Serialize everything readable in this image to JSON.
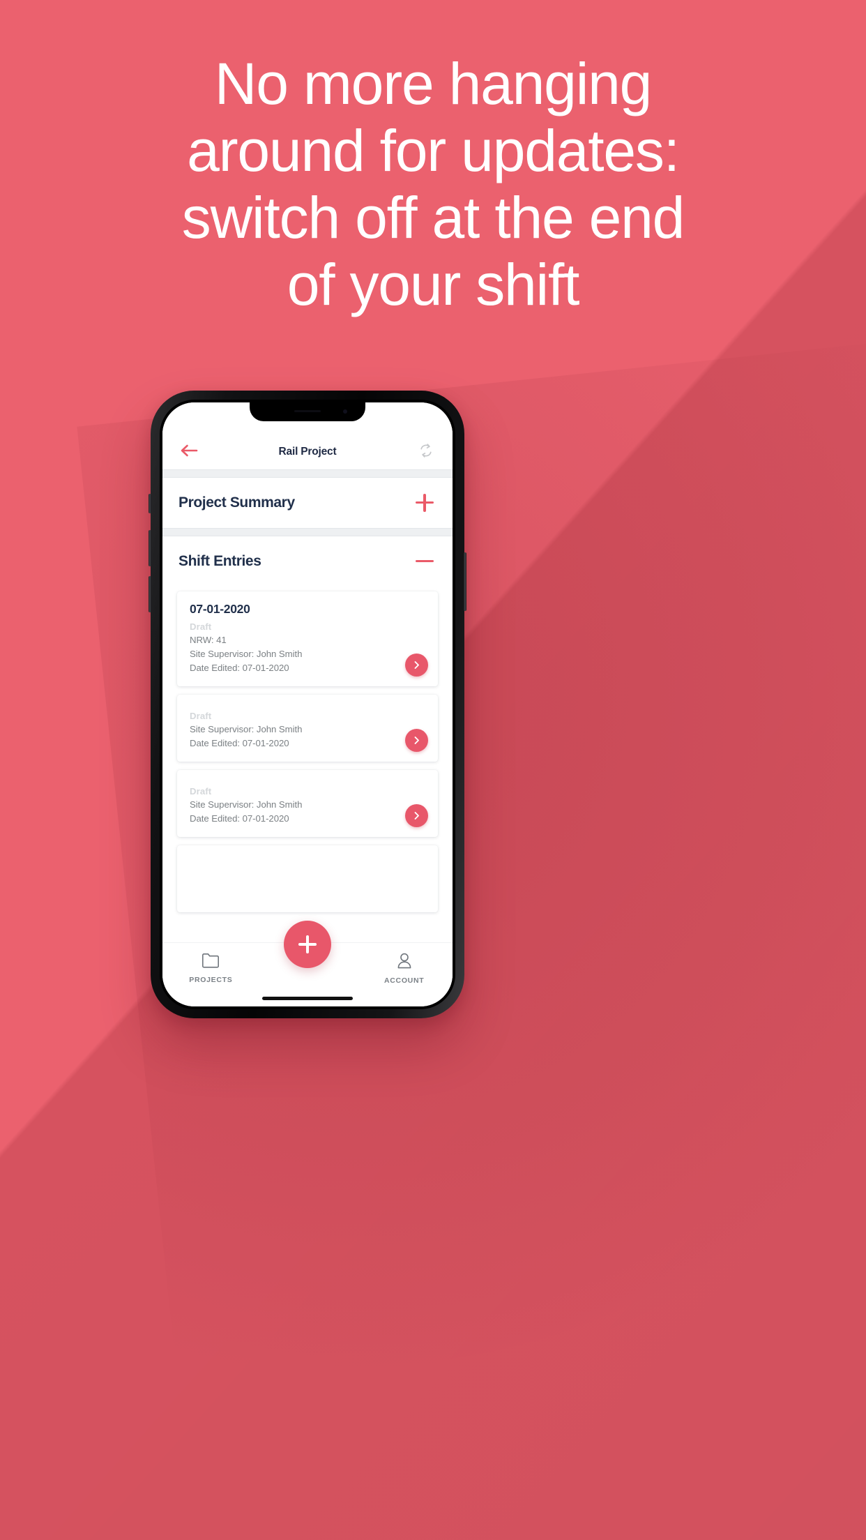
{
  "promo": {
    "background_color": "#ea5a68",
    "headline_color": "#ffffff",
    "headline_lines": [
      "No more hanging",
      "around for updates:",
      "switch off at the end",
      "of your shift"
    ]
  },
  "theme": {
    "accent": "#ea5a68",
    "accent_dark": "#e8576a",
    "title_text": "#21304b",
    "body_text": "#7b8084",
    "muted_text": "#d4d7da",
    "divider": "#eef0f2"
  },
  "app": {
    "appbar": {
      "back_icon": "arrow-left-icon",
      "title": "Rail Project",
      "refresh_icon": "refresh-icon"
    },
    "sections": [
      {
        "title": "Project Summary",
        "toggle": "plus-icon",
        "expanded": false
      },
      {
        "title": "Shift Entries",
        "toggle": "minus-icon",
        "expanded": true
      }
    ],
    "shift_entries": [
      {
        "date": "07-01-2020",
        "status": "Draft",
        "nrw": "NRW: 41",
        "supervisor": "Site Supervisor: John Smith",
        "date_edited": "Date Edited: 07-01-2020",
        "chevron_icon": "chevron-right-icon"
      },
      {
        "date": "",
        "status": "Draft",
        "nrw": "",
        "supervisor": "Site Supervisor: John Smith",
        "date_edited": "Date Edited: 07-01-2020",
        "chevron_icon": "chevron-right-icon"
      },
      {
        "date": "",
        "status": "Draft",
        "nrw": "",
        "supervisor": "Site Supervisor: John Smith",
        "date_edited": "Date Edited: 07-01-2020",
        "chevron_icon": "chevron-right-icon"
      }
    ],
    "tabbar": {
      "items": [
        {
          "label": "PROJECTS",
          "icon": "folder-icon"
        },
        {
          "label": "ACCOUNT",
          "icon": "person-icon"
        }
      ],
      "fab": {
        "icon": "plus-icon",
        "label": ""
      }
    }
  }
}
